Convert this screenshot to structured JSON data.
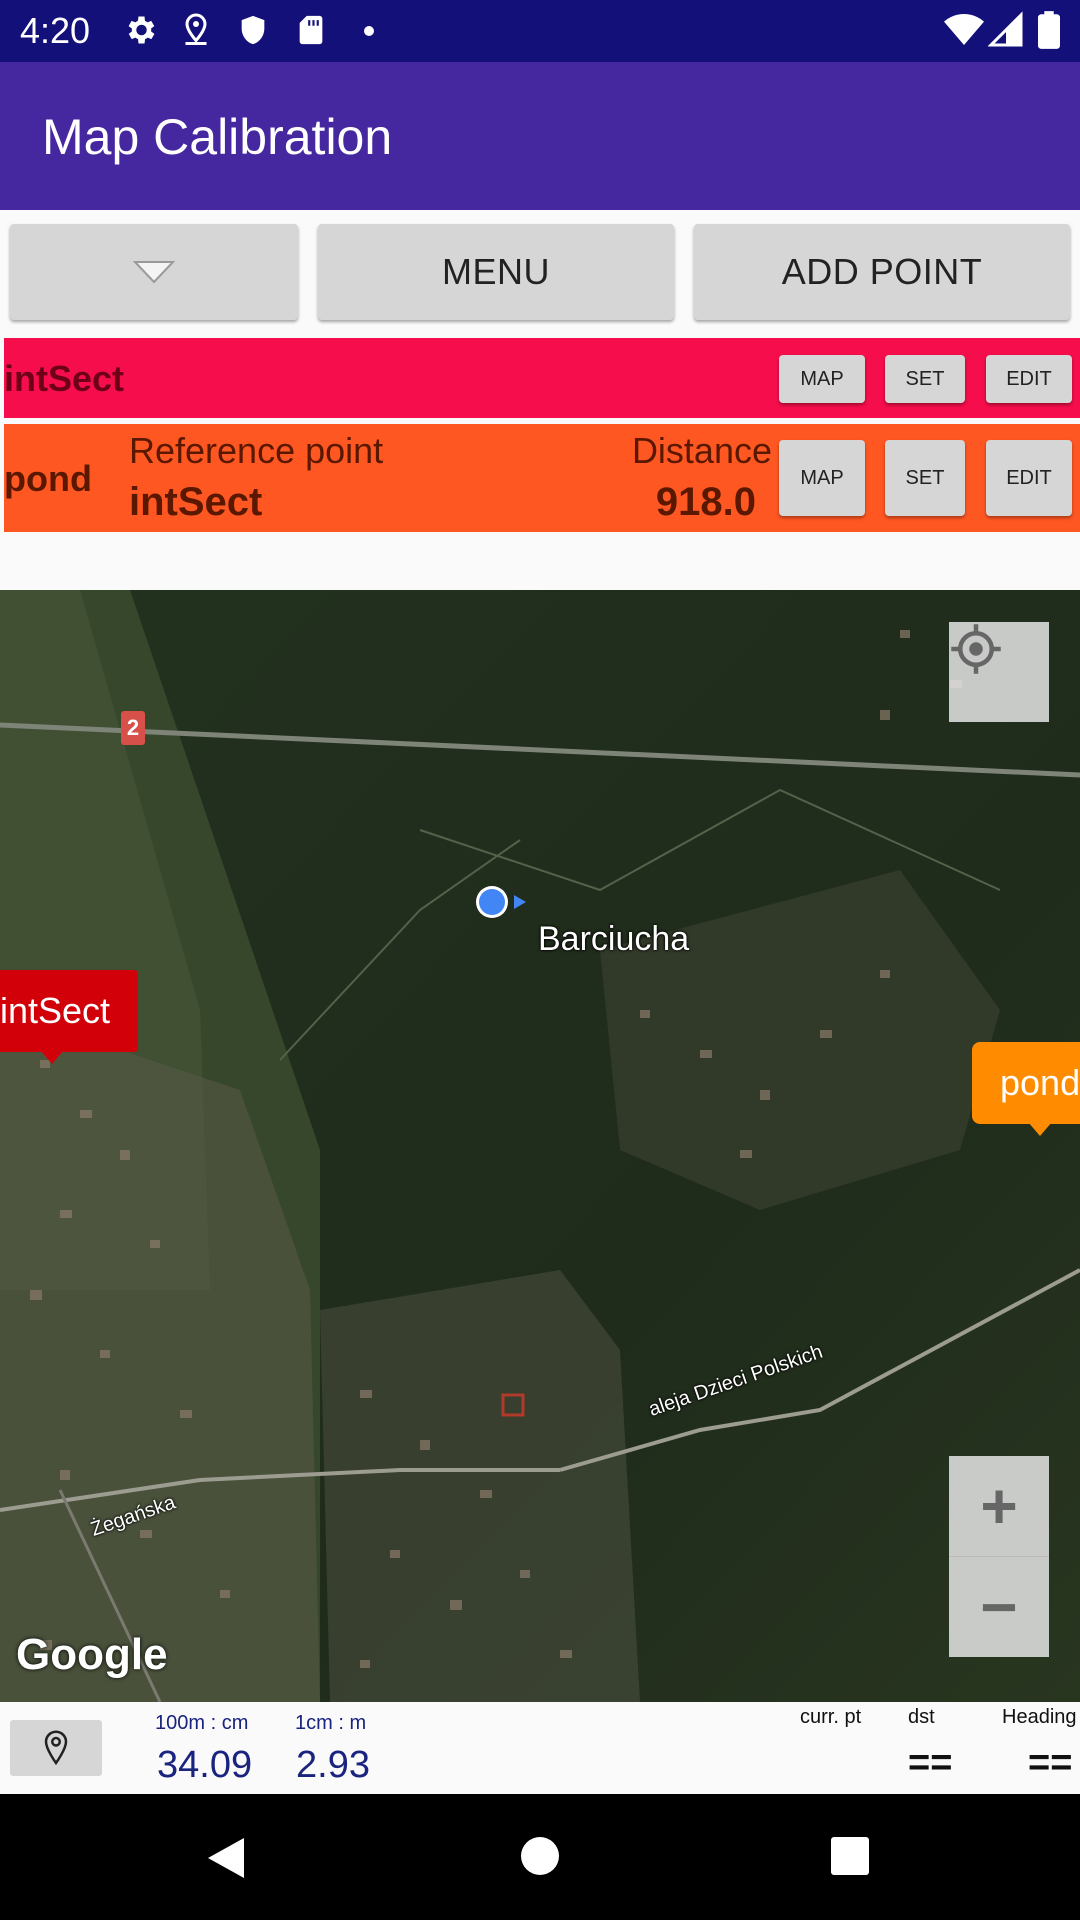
{
  "status_bar": {
    "time": "4:20"
  },
  "app_bar": {
    "title": "Map Calibration"
  },
  "toolbar": {
    "menu_label": "MENU",
    "add_point_label": "ADD POINT"
  },
  "points": [
    {
      "name": "intSect",
      "map_label": "MAP",
      "set_label": "SET",
      "edit_label": "EDIT",
      "color": "#f50e4b"
    },
    {
      "name": "pond",
      "reference_label": "Reference point",
      "reference_value": "intSect",
      "distance_label": "Distance",
      "distance_value": "918.0",
      "map_label": "MAP",
      "set_label": "SET",
      "edit_label": "EDIT",
      "color": "#ff5722"
    }
  ],
  "map": {
    "place_label": "Barciucha",
    "street_1": "aleja Dzieci Polskich",
    "street_2": "Żegańska",
    "road_badge": "2",
    "marker_intsect": "intSect",
    "marker_pond": "pond",
    "google_logo": "Google",
    "zoom_in": "+",
    "zoom_out": "−"
  },
  "bottom_bar": {
    "scale1_label": "100m : cm",
    "scale1_value": "34.09",
    "scale2_label": "1cm : m",
    "scale2_value": "2.93",
    "curr_label": "curr. pt",
    "dst_label": "dst",
    "dst_value": "==",
    "heading_label": "Heading",
    "heading_value": "=="
  }
}
